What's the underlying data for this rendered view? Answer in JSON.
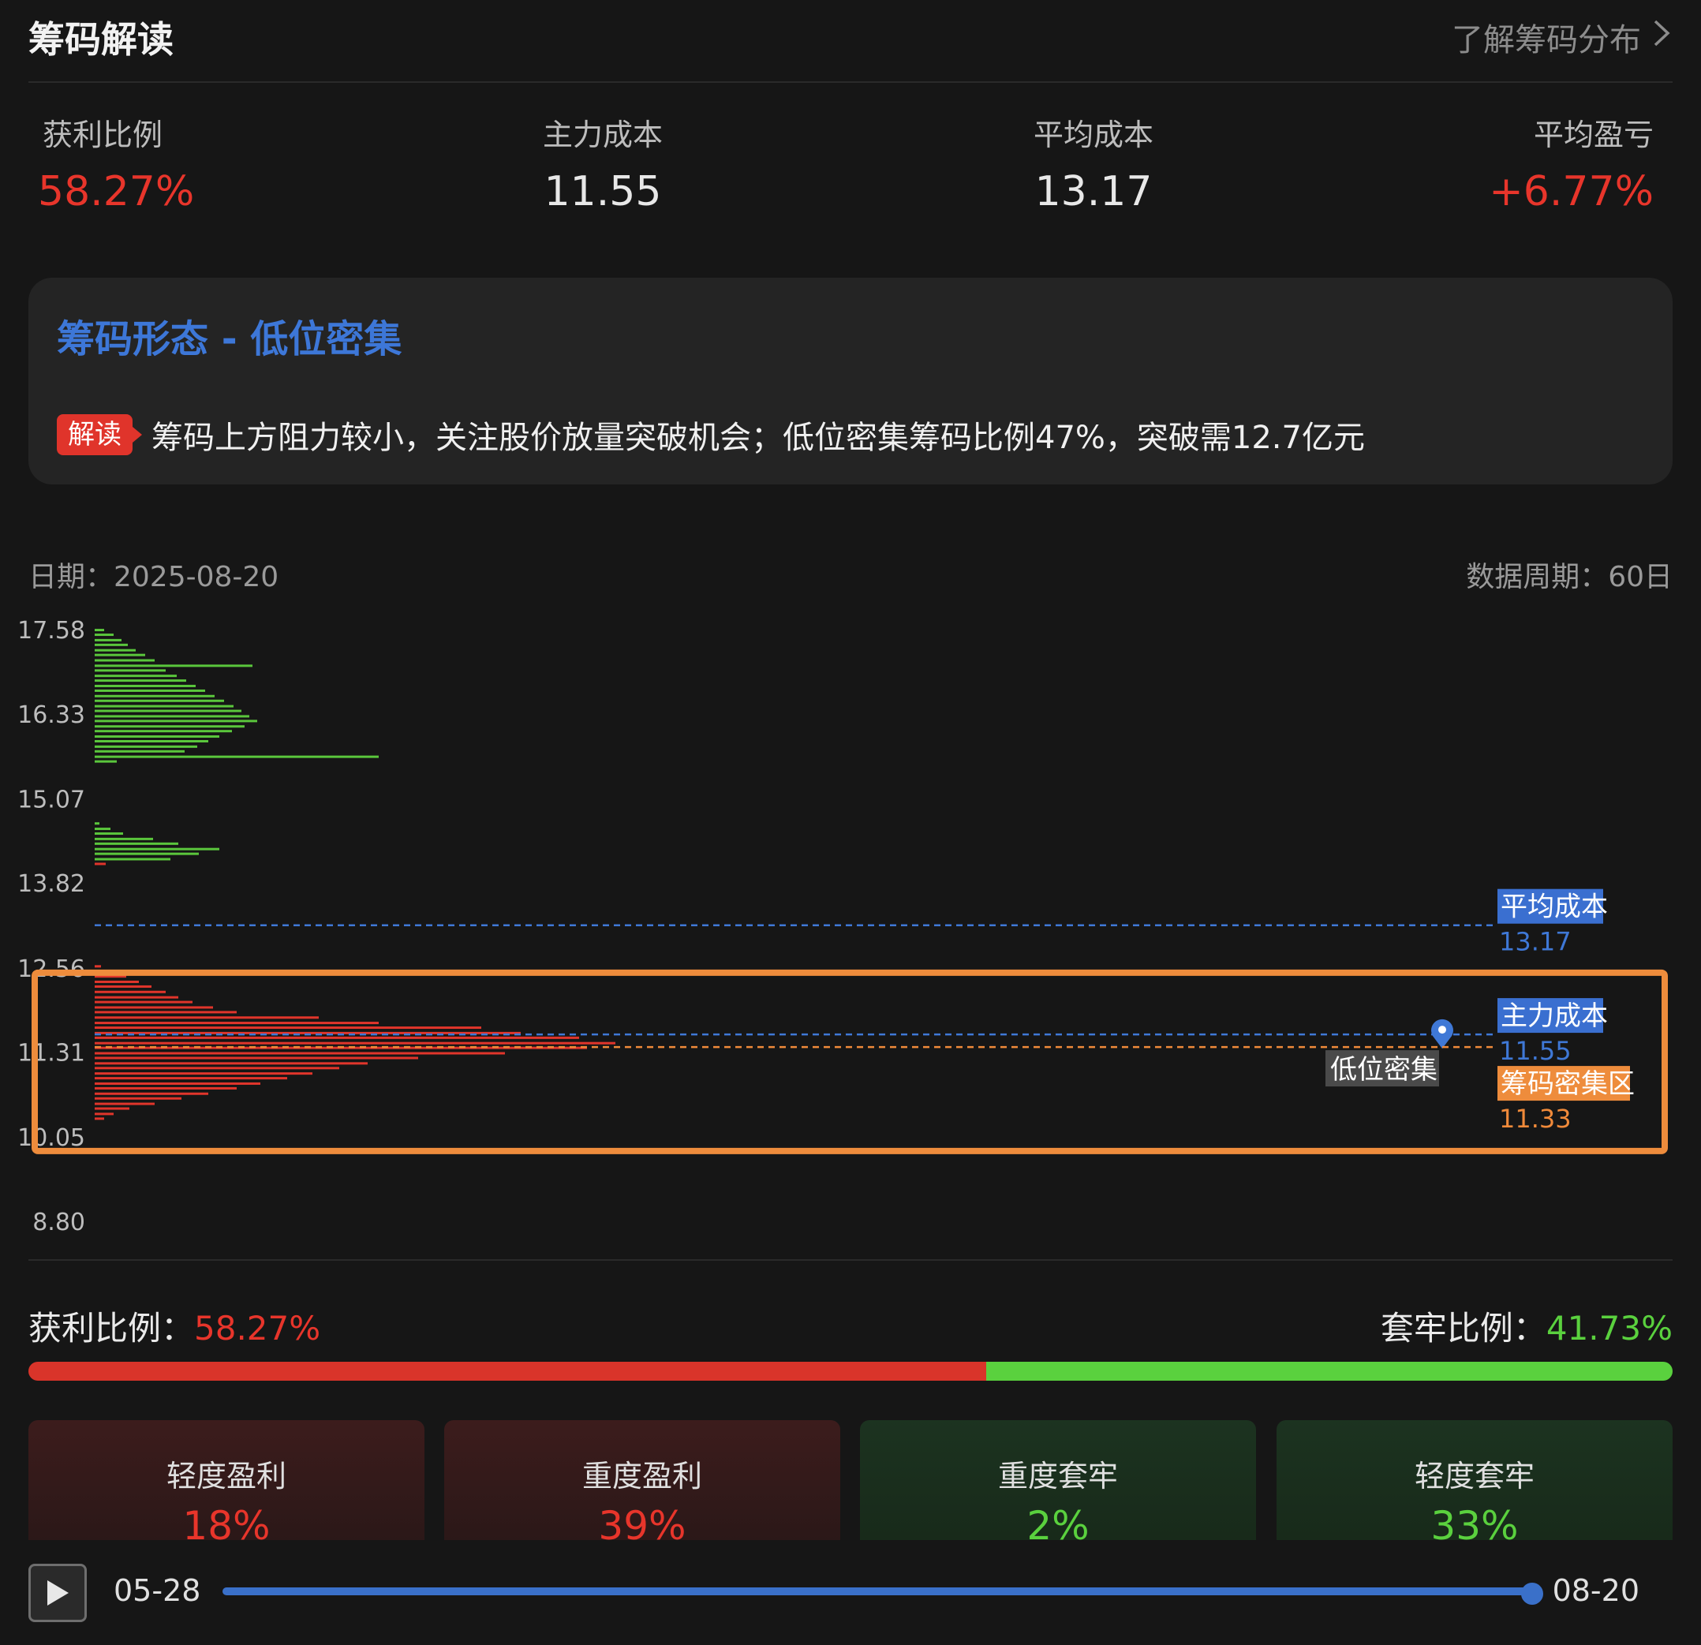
{
  "header": {
    "title": "筹码解读",
    "learn_more": "了解筹码分布"
  },
  "stats": [
    {
      "label": "获利比例",
      "value": "58.27%",
      "color": "#e8352b"
    },
    {
      "label": "主力成本",
      "value": "11.55",
      "color": "#f0f0f0"
    },
    {
      "label": "平均成本",
      "value": "13.17",
      "color": "#f0f0f0"
    },
    {
      "label": "平均盈亏",
      "value": "+6.77%",
      "color": "#e8352b"
    }
  ],
  "pattern": {
    "title": "筹码形态 - 低位密集",
    "badge": "解读",
    "text": "筹码上方阻力较小，关注股价放量突破机会；低位密集筹码比例47%，突破需12.7亿元"
  },
  "chart_meta": {
    "date": "日期：2025-08-20",
    "period": "数据周期：60日"
  },
  "chart_data": {
    "type": "bar",
    "orientation": "horizontal",
    "ylim": [
      8.8,
      17.58
    ],
    "y_ticks": [
      "17.58",
      "16.33",
      "15.07",
      "13.82",
      "12.56",
      "11.31",
      "10.05",
      "8.80"
    ],
    "markers": [
      {
        "name": "平均成本",
        "value": "13.17",
        "color": "#3f78d6"
      },
      {
        "name": "主力成本",
        "value": "11.55",
        "color": "#3f78d6"
      },
      {
        "name": "筹码密集区",
        "value": "11.33",
        "color": "#f08a3a"
      }
    ],
    "zone_label": "低位密集",
    "green_bars": [
      [
        17.55,
        0.06
      ],
      [
        17.48,
        0.12
      ],
      [
        17.4,
        0.17
      ],
      [
        17.33,
        0.21
      ],
      [
        17.25,
        0.26
      ],
      [
        17.18,
        0.32
      ],
      [
        17.1,
        0.38
      ],
      [
        17.02,
        1.0
      ],
      [
        16.95,
        0.45
      ],
      [
        16.87,
        0.52
      ],
      [
        16.8,
        0.58
      ],
      [
        16.72,
        0.64
      ],
      [
        16.65,
        0.7
      ],
      [
        16.57,
        0.76
      ],
      [
        16.5,
        0.82
      ],
      [
        16.42,
        0.88
      ],
      [
        16.35,
        0.93
      ],
      [
        16.27,
        0.98
      ],
      [
        16.2,
        1.03
      ],
      [
        16.12,
        0.95
      ],
      [
        16.05,
        0.87
      ],
      [
        15.97,
        0.79
      ],
      [
        15.9,
        0.72
      ],
      [
        15.82,
        0.65
      ],
      [
        15.75,
        0.57
      ],
      [
        15.67,
        1.8
      ],
      [
        15.6,
        0.14
      ],
      [
        14.68,
        0.03
      ],
      [
        14.6,
        0.1
      ],
      [
        14.53,
        0.18
      ],
      [
        14.45,
        0.37
      ],
      [
        14.38,
        0.53
      ],
      [
        14.3,
        0.79
      ],
      [
        14.23,
        0.66
      ],
      [
        14.15,
        0.48
      ]
    ],
    "red_bars": [
      [
        14.08,
        0.07
      ],
      [
        12.56,
        0.04
      ],
      [
        12.49,
        0.12
      ],
      [
        12.41,
        0.2
      ],
      [
        12.33,
        0.28
      ],
      [
        12.26,
        0.36
      ],
      [
        12.18,
        0.45
      ],
      [
        12.1,
        0.53
      ],
      [
        12.03,
        0.62
      ],
      [
        11.95,
        0.75
      ],
      [
        11.88,
        0.9
      ],
      [
        11.8,
        1.42
      ],
      [
        11.72,
        1.8
      ],
      [
        11.65,
        2.45
      ],
      [
        11.57,
        2.7
      ],
      [
        11.5,
        3.07
      ],
      [
        11.42,
        3.3
      ],
      [
        11.35,
        3.12
      ],
      [
        11.27,
        2.6
      ],
      [
        11.2,
        2.05
      ],
      [
        11.12,
        1.73
      ],
      [
        11.05,
        1.55
      ],
      [
        10.97,
        1.38
      ],
      [
        10.9,
        1.22
      ],
      [
        10.82,
        1.05
      ],
      [
        10.75,
        0.9
      ],
      [
        10.67,
        0.72
      ],
      [
        10.6,
        0.55
      ],
      [
        10.52,
        0.38
      ],
      [
        10.45,
        0.22
      ],
      [
        10.37,
        0.12
      ],
      [
        10.3,
        0.06
      ]
    ]
  },
  "ratio": {
    "profit_label": "获利比例：",
    "profit_value": "58.27%",
    "profit_fraction": 0.5827,
    "loss_label": "套牢比例：",
    "loss_value": "41.73%"
  },
  "cards": [
    {
      "label": "轻度盈利",
      "value": "18%",
      "tone": "r"
    },
    {
      "label": "重度盈利",
      "value": "39%",
      "tone": "r"
    },
    {
      "label": "重度套牢",
      "value": "2%",
      "tone": "g"
    },
    {
      "label": "轻度套牢",
      "value": "33%",
      "tone": "g"
    }
  ],
  "player": {
    "start": "05-28",
    "end": "08-20"
  }
}
